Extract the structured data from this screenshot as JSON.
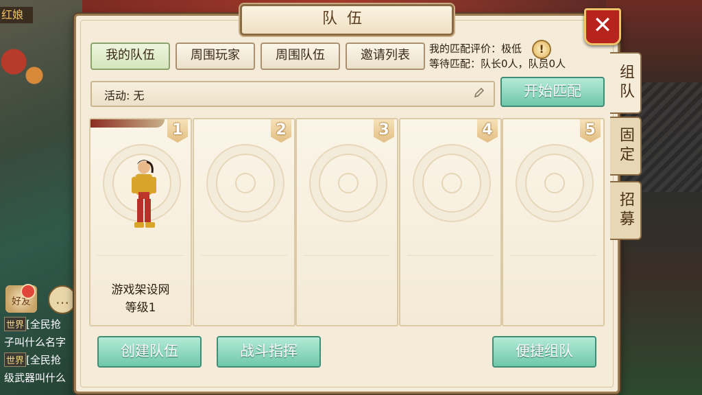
{
  "hud": {
    "player_name_fragment": "红娘",
    "friends_label": "好友",
    "chat_lines": [
      {
        "tag": "世界",
        "text": "[全民抢"
      },
      {
        "tag": "",
        "text": "子叫什么名字"
      },
      {
        "tag": "世界",
        "text": "[全民抢"
      },
      {
        "tag": "",
        "text": "级武器叫什么"
      }
    ]
  },
  "panel": {
    "title": "队伍",
    "close_symbol": "✕"
  },
  "side_tabs": [
    {
      "label": "组队",
      "active": true
    },
    {
      "label": "固定",
      "active": false
    },
    {
      "label": "招募",
      "active": false
    }
  ],
  "top_tabs": [
    {
      "label": "我的队伍",
      "selected": true
    },
    {
      "label": "周围玩家",
      "selected": false
    },
    {
      "label": "周围队伍",
      "selected": false
    },
    {
      "label": "邀请列表",
      "selected": false
    }
  ],
  "match_info": {
    "rating": "我的匹配评价：极低",
    "waiting": "等待匹配：队长0人，队员0人",
    "warn_symbol": "!"
  },
  "activity": {
    "label": "活动: 无"
  },
  "start_match_label": "开始匹配",
  "slots": [
    {
      "number": "1",
      "name": "游戏架设网",
      "level": "等级1",
      "occupied": true
    },
    {
      "number": "2",
      "name": "",
      "level": "",
      "occupied": false
    },
    {
      "number": "3",
      "name": "",
      "level": "",
      "occupied": false
    },
    {
      "number": "4",
      "name": "",
      "level": "",
      "occupied": false
    },
    {
      "number": "5",
      "name": "",
      "level": "",
      "occupied": false
    }
  ],
  "bottom_buttons": {
    "create_team": "创建队伍",
    "battle_command": "战斗指挥",
    "quick_team": "便捷组队"
  },
  "colors": {
    "panel_bg": "#f4ecd9",
    "green_button": "#6fc8aa",
    "close_red": "#b7241e"
  }
}
